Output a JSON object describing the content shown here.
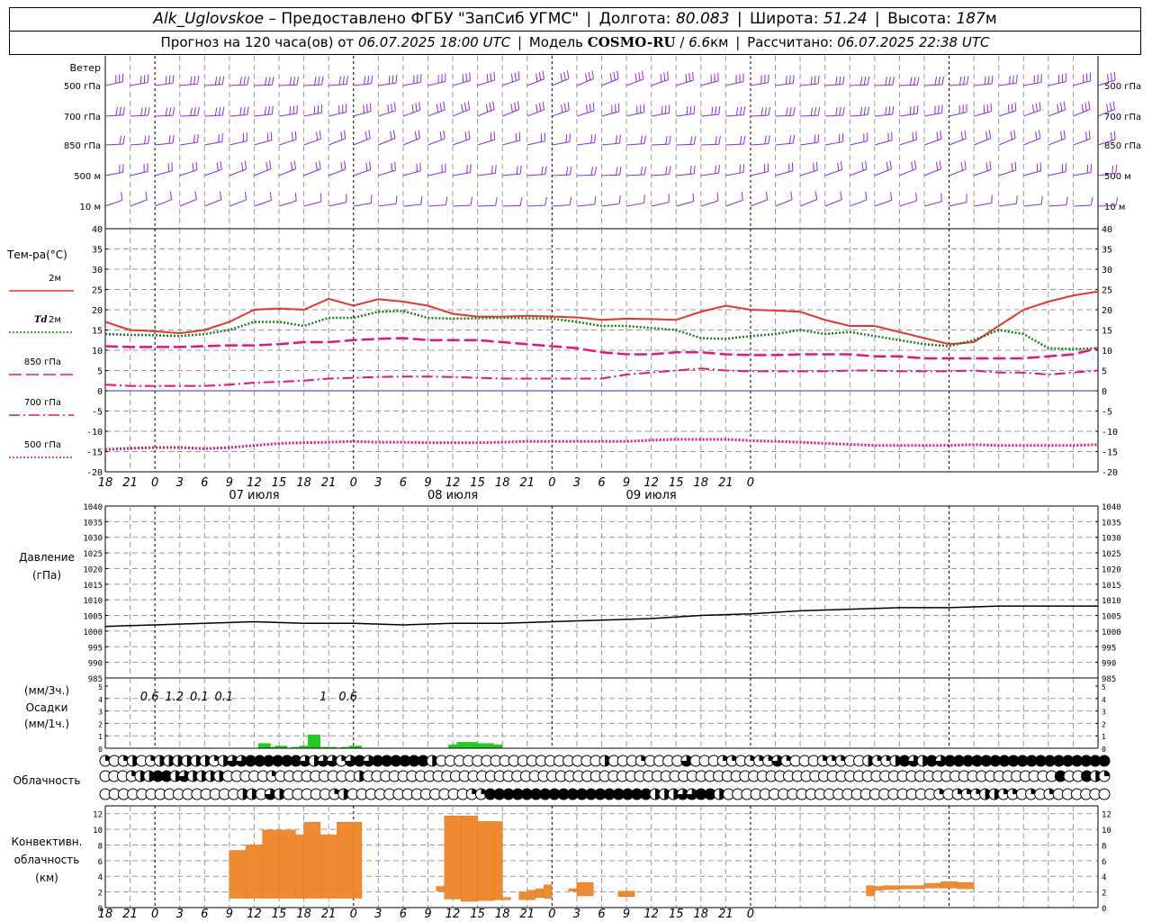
{
  "header": {
    "station": "Alk_Uglovskoe",
    "dash": " – ",
    "provider": "Предоставлено ФГБУ \"ЗапСиб УГМС\"",
    "sep": "|",
    "lon_label": "Долгота:",
    "lon_value": "80.083",
    "lat_label": "Широта:",
    "lat_value": "51.24",
    "alt_label": "Высота:",
    "alt_value": "187",
    "alt_unit": "м",
    "forecast_prefix": "Прогноз на 120 часа(ов) от",
    "forecast_time": "06.07.2025 18:00 UTC",
    "model_label": "Модель",
    "model_name": "COSMO-RU",
    "model_slash": "/",
    "model_res": "6.6",
    "model_res_unit": "км",
    "computed_label": "Рассчитано:",
    "computed_time": "06.07.2025 22:38 UTC"
  },
  "colors": {
    "grid": "#999999",
    "wind": "#8a2be2",
    "t2m": "#e8352e",
    "td2m": "#1a7a1a",
    "t850": "#e8127c",
    "t700": "#e8127c",
    "t500": "#e8127c",
    "zero": "#3030c0",
    "precip": "#22cc22",
    "conv": "#f08a30",
    "pressure": "#000000"
  },
  "time_axis": {
    "hour_ticks": [
      "18",
      "21",
      "0",
      "3",
      "6",
      "9",
      "12",
      "15",
      "18",
      "21",
      "0",
      "3",
      "6",
      "9",
      "12",
      "15",
      "18",
      "21",
      "0",
      "3",
      "6",
      "9",
      "12",
      "15",
      "18",
      "21",
      "0"
    ],
    "day_labels": [
      "07 июля",
      "08 июля",
      "09 июля"
    ]
  },
  "wind_panel": {
    "title": "Ветер",
    "levels": [
      "500 гПа",
      "700 гПа",
      "850 гПа",
      "500 м",
      "10 м"
    ],
    "level_speeds": [
      10,
      8,
      6,
      5,
      3
    ],
    "icon": "wind-barb"
  },
  "temp_panel": {
    "title": "Тем-ра(°C)",
    "ylim": [
      -20,
      40
    ],
    "y_ticks": [
      "40",
      "35",
      "30",
      "25",
      "20",
      "15",
      "10",
      "5",
      "0",
      "-5",
      "-10",
      "-15",
      "-20"
    ],
    "legend": [
      {
        "label": "2м",
        "key": "t2m",
        "style": "solid"
      },
      {
        "label": "Td",
        "label2": "2м",
        "key": "td2m",
        "style": "dotted"
      },
      {
        "label": "850 гПа",
        "key": "t850",
        "style": "dashed"
      },
      {
        "label": "700 гПа",
        "key": "t700",
        "style": "dashdot"
      },
      {
        "label": "500 гПа",
        "key": "t500",
        "style": "dotted"
      }
    ]
  },
  "pressure_panel": {
    "title": "Давление",
    "unit": "(гПа)",
    "ylim": [
      985,
      1040
    ],
    "y_ticks": [
      "1040",
      "1035",
      "1030",
      "1025",
      "1020",
      "1015",
      "1010",
      "1005",
      "1000",
      "995",
      "990",
      "985"
    ]
  },
  "precip_panel": {
    "unit_top": "(мм/3ч.)",
    "title": "Осадки",
    "unit_bottom": "(мм/1ч.)",
    "ylim": [
      0,
      5
    ],
    "y_ticks": [
      "5",
      "4",
      "3",
      "2",
      "1",
      "0"
    ],
    "totals": [
      {
        "hour": 6,
        "text": "0.6"
      },
      {
        "hour": 9,
        "text": "1.2"
      },
      {
        "hour": 12,
        "text": "0.1"
      },
      {
        "hour": 15,
        "text": "0.1"
      },
      {
        "hour": 27,
        "text": "1"
      },
      {
        "hour": 30,
        "text": "0.6"
      }
    ]
  },
  "cloud_panel": {
    "title": "Облачность",
    "rows": [
      "upper",
      "middle",
      "lower"
    ],
    "icon": "cloud-cover-circle"
  },
  "conv_panel": {
    "title_lines": [
      "Конвективн.",
      "облачность",
      "(км)"
    ],
    "ylim": [
      0,
      13
    ],
    "y_ticks": [
      "12",
      "10",
      "8",
      "6",
      "4",
      "2",
      "0"
    ]
  },
  "chart_data": [
    {
      "type": "line",
      "title": "Тем-ра(°C)",
      "x_unit": "hours since 06.07.2025 18:00 UTC",
      "x": [
        0,
        3,
        6,
        9,
        12,
        15,
        18,
        21,
        24,
        27,
        30,
        33,
        36,
        39,
        42,
        45,
        48,
        51,
        54,
        57,
        60,
        63,
        66,
        69,
        72,
        75,
        78,
        81,
        84,
        87,
        90,
        93,
        96,
        99,
        102,
        105,
        108,
        111,
        114,
        117,
        120
      ],
      "ylim": [
        -20,
        40
      ],
      "series": [
        {
          "name": "2м",
          "key": "t2m",
          "values": [
            17,
            15,
            14.7,
            14.2,
            15,
            17,
            20,
            20.3,
            20,
            22.7,
            21,
            22.6,
            22,
            21,
            19,
            18.3,
            18.3,
            18.5,
            18.3,
            18.1,
            17.5,
            17.8,
            17.7,
            17.5,
            19.5,
            21,
            20,
            19.8,
            19.5,
            17.5,
            16,
            16,
            14.5,
            13,
            11.5,
            12,
            16,
            20,
            22,
            23.5,
            24.5
          ]
        },
        {
          "name": "Td 2м",
          "key": "td2m",
          "values": [
            14,
            13.8,
            13.7,
            13.5,
            14,
            15,
            17,
            17,
            16,
            18,
            18,
            19.5,
            19.7,
            18,
            17.8,
            17.9,
            18,
            17.9,
            17.8,
            17,
            16,
            16,
            15.5,
            15,
            13,
            12.8,
            13.5,
            14,
            15,
            14,
            14.5,
            13.5,
            12.5,
            11.5,
            11,
            12.5,
            15,
            14,
            10.5,
            10.3,
            10.5
          ]
        },
        {
          "name": "850 гПа",
          "key": "t850",
          "values": [
            11,
            10.8,
            10.8,
            10.8,
            11,
            11.2,
            11.2,
            11.5,
            12,
            12,
            12.5,
            12.8,
            13,
            12.5,
            12.5,
            12.5,
            12,
            11.5,
            11,
            10.5,
            9.5,
            9,
            9,
            9.5,
            9.5,
            9,
            8.8,
            8.8,
            9,
            9,
            9,
            8.5,
            8.5,
            8,
            8,
            8,
            8,
            8,
            8.5,
            9,
            10.5
          ]
        },
        {
          "name": "700 гПа",
          "key": "t700",
          "values": [
            1.5,
            1.2,
            1.2,
            1.2,
            1.2,
            1.5,
            2,
            2.2,
            2.5,
            3,
            3.2,
            3.4,
            3.5,
            3.5,
            3.4,
            3.2,
            3,
            3,
            3,
            3,
            3,
            4,
            4.5,
            5,
            5.5,
            5,
            4.8,
            4.8,
            4.8,
            4.8,
            5,
            5,
            4.8,
            4.8,
            4.8,
            5,
            4.5,
            4.5,
            4,
            4.5,
            5
          ]
        },
        {
          "name": "500 гПа",
          "key": "t500",
          "values": [
            -14.5,
            -14.2,
            -14,
            -14,
            -14.3,
            -14,
            -13.5,
            -13,
            -12.8,
            -12.7,
            -12.5,
            -12.7,
            -12.7,
            -12.8,
            -12.8,
            -12.8,
            -12.7,
            -12.5,
            -12.5,
            -12.5,
            -12.5,
            -12.5,
            -12.2,
            -12,
            -12,
            -12,
            -12.3,
            -12.5,
            -12.7,
            -13,
            -13.2,
            -13.5,
            -13.5,
            -13.5,
            -13.5,
            -13.3,
            -13.5,
            -13.5,
            -13.5,
            -13.5,
            -13.3
          ]
        }
      ]
    },
    {
      "type": "line",
      "title": "Давление",
      "x_unit": "hours since 06.07.2025 18:00 UTC",
      "x": [
        0,
        6,
        12,
        18,
        24,
        30,
        36,
        42,
        48,
        54,
        60,
        66,
        72,
        78,
        84,
        90,
        96,
        102,
        108,
        114,
        120
      ],
      "ylim": [
        985,
        1040
      ],
      "series": [
        {
          "name": "Давление",
          "key": "pressure",
          "values": [
            1001.5,
            1002,
            1002.5,
            1003,
            1002.5,
            1002.5,
            1002,
            1002.5,
            1002.5,
            1003,
            1003.5,
            1004,
            1005,
            1005.5,
            1006.5,
            1007,
            1007.5,
            1007.5,
            1008,
            1008,
            1008
          ]
        }
      ]
    },
    {
      "type": "bar",
      "title": "Осадки",
      "x_unit": "hours since 06.07.2025 18:00 UTC",
      "x": [
        15,
        16,
        17,
        18,
        19,
        20,
        21,
        22,
        24,
        25,
        26,
        27,
        28,
        29,
        30,
        31,
        32,
        33,
        34,
        35,
        36,
        37,
        42,
        43,
        44,
        45,
        46,
        47,
        48,
        49,
        50,
        51,
        52
      ],
      "values": [
        0,
        0,
        0,
        0,
        0,
        0.4,
        0.1,
        0.2,
        0.1,
        0.2,
        1.1,
        0.1,
        0.1,
        0,
        0.1,
        0.2,
        0,
        0,
        0,
        0,
        0,
        0,
        0,
        0.3,
        0.5,
        0.5,
        0.4,
        0.4,
        0.3,
        0,
        0,
        0,
        0
      ],
      "ylim": [
        0,
        5
      ]
    },
    {
      "type": "bar",
      "title": "Конвективн. облачность (км)",
      "x_unit": "hours since 06.07.2025 18:00 UTC",
      "bars": [
        {
          "x0": 15,
          "x1": 17,
          "base": 1.2,
          "top": 7.3
        },
        {
          "x0": 17,
          "x1": 19,
          "base": 1.2,
          "top": 8
        },
        {
          "x0": 19,
          "x1": 21,
          "base": 1.2,
          "top": 9.9
        },
        {
          "x0": 21,
          "x1": 23,
          "base": 1.2,
          "top": 9.9
        },
        {
          "x0": 23,
          "x1": 24,
          "base": 1.2,
          "top": 9.3
        },
        {
          "x0": 24,
          "x1": 26,
          "base": 1.2,
          "top": 10.9
        },
        {
          "x0": 26,
          "x1": 28,
          "base": 1.2,
          "top": 9.3
        },
        {
          "x0": 28,
          "x1": 30,
          "base": 1.2,
          "top": 10.9
        },
        {
          "x0": 30,
          "x1": 31,
          "base": 1.2,
          "top": 10.9
        },
        {
          "x0": 40,
          "x1": 41,
          "base": 2.1,
          "top": 2.7
        },
        {
          "x0": 41,
          "x1": 43,
          "base": 1.1,
          "top": 11.7
        },
        {
          "x0": 43,
          "x1": 45,
          "base": 0.8,
          "top": 11.7
        },
        {
          "x0": 45,
          "x1": 47,
          "base": 0.9,
          "top": 11
        },
        {
          "x0": 47,
          "x1": 48,
          "base": 1,
          "top": 11
        },
        {
          "x0": 48,
          "x1": 49,
          "base": 1,
          "top": 1.3
        },
        {
          "x0": 50,
          "x1": 51,
          "base": 1,
          "top": 2
        },
        {
          "x0": 51,
          "x1": 52,
          "base": 1,
          "top": 2.2
        },
        {
          "x0": 52,
          "x1": 53,
          "base": 1.3,
          "top": 2.4
        },
        {
          "x0": 53,
          "x1": 54,
          "base": 1.2,
          "top": 2.9
        },
        {
          "x0": 56,
          "x1": 57,
          "base": 2.1,
          "top": 2.4
        },
        {
          "x0": 57,
          "x1": 59,
          "base": 1.5,
          "top": 3.2
        },
        {
          "x0": 62,
          "x1": 64,
          "base": 1.4,
          "top": 2.1
        },
        {
          "x0": 92,
          "x1": 93,
          "base": 1.5,
          "top": 2.8
        },
        {
          "x0": 93,
          "x1": 94,
          "base": 2.2,
          "top": 2.7
        },
        {
          "x0": 94,
          "x1": 96,
          "base": 2.3,
          "top": 2.8
        },
        {
          "x0": 96,
          "x1": 99,
          "base": 2.4,
          "top": 2.8
        },
        {
          "x0": 99,
          "x1": 101,
          "base": 2.5,
          "top": 3.1
        },
        {
          "x0": 101,
          "x1": 103,
          "base": 2.5,
          "top": 3.3
        },
        {
          "x0": 103,
          "x1": 105,
          "base": 2.4,
          "top": 3.2
        }
      ],
      "ylim": [
        0,
        13
      ]
    },
    {
      "type": "table",
      "title": "Облачность",
      "x_unit": "hours since 06.07.2025 18:00 UTC, one symbol per hour",
      "value_unit": "octas",
      "rows": {
        "upper": [
          2,
          0,
          2,
          4,
          0,
          2,
          4,
          4,
          4,
          4,
          4,
          4,
          2,
          4,
          6,
          6,
          8,
          8,
          8,
          8,
          8,
          8,
          6,
          4,
          6,
          6,
          2,
          6,
          8,
          6,
          8,
          8,
          8,
          8,
          8,
          8,
          4,
          0,
          0,
          0,
          0,
          0,
          0,
          0,
          0,
          0,
          0,
          0,
          0,
          0,
          0,
          0,
          0,
          0,
          0,
          4,
          0,
          0,
          0,
          2,
          0,
          0,
          0,
          0,
          6,
          0,
          0,
          0,
          2,
          2,
          0,
          2,
          2,
          2,
          6,
          2,
          0,
          0,
          0,
          2,
          2,
          2,
          0,
          0,
          4,
          2,
          2,
          4,
          8,
          6,
          4,
          8,
          6,
          8,
          8,
          8,
          8,
          8,
          8,
          8,
          8,
          8,
          8,
          8,
          8,
          8,
          8,
          8,
          8,
          8,
          8
        ],
        "middle": [
          0,
          0,
          0,
          2,
          4,
          4,
          8,
          8,
          4,
          6,
          4,
          4,
          4,
          4,
          0,
          0,
          0,
          0,
          0,
          2,
          0,
          0,
          0,
          0,
          0,
          0,
          0,
          0,
          0,
          4,
          0,
          0,
          0,
          0,
          0,
          0,
          0,
          0,
          0,
          0,
          0,
          0,
          0,
          0,
          0,
          0,
          0,
          0,
          0,
          0,
          0,
          0,
          0,
          0,
          0,
          0,
          0,
          0,
          0,
          0,
          0,
          0,
          0,
          0,
          0,
          0,
          0,
          0,
          0,
          0,
          0,
          0,
          0,
          0,
          0,
          0,
          0,
          0,
          0,
          0,
          0,
          0,
          0,
          0,
          0,
          0,
          0,
          0,
          0,
          0,
          0,
          0,
          0,
          0,
          0,
          0,
          0,
          0,
          0,
          0,
          0,
          0,
          0,
          0,
          0,
          0,
          0,
          0,
          0,
          8,
          0,
          0,
          8,
          4,
          2
        ],
        "lower": [
          0,
          0,
          0,
          0,
          0,
          0,
          0,
          0,
          0,
          0,
          0,
          0,
          0,
          0,
          0,
          4,
          4,
          0,
          6,
          4,
          0,
          0,
          0,
          0,
          0,
          2,
          4,
          0,
          0,
          0,
          0,
          0,
          0,
          0,
          0,
          0,
          0,
          0,
          0,
          0,
          2,
          2,
          8,
          8,
          8,
          8,
          8,
          8,
          8,
          8,
          8,
          8,
          8,
          8,
          8,
          8,
          8,
          8,
          8,
          8,
          4,
          4,
          4,
          6,
          6,
          8,
          8,
          4,
          0,
          0,
          0,
          0,
          0,
          0,
          0,
          0,
          0,
          0,
          0,
          0,
          0,
          0,
          0,
          0,
          0,
          0,
          0,
          0,
          0,
          0,
          0,
          2,
          0,
          2,
          2,
          2,
          4,
          4,
          2,
          2,
          0,
          2,
          0,
          2,
          0,
          0,
          0,
          0,
          0,
          0
        ]
      }
    }
  ]
}
